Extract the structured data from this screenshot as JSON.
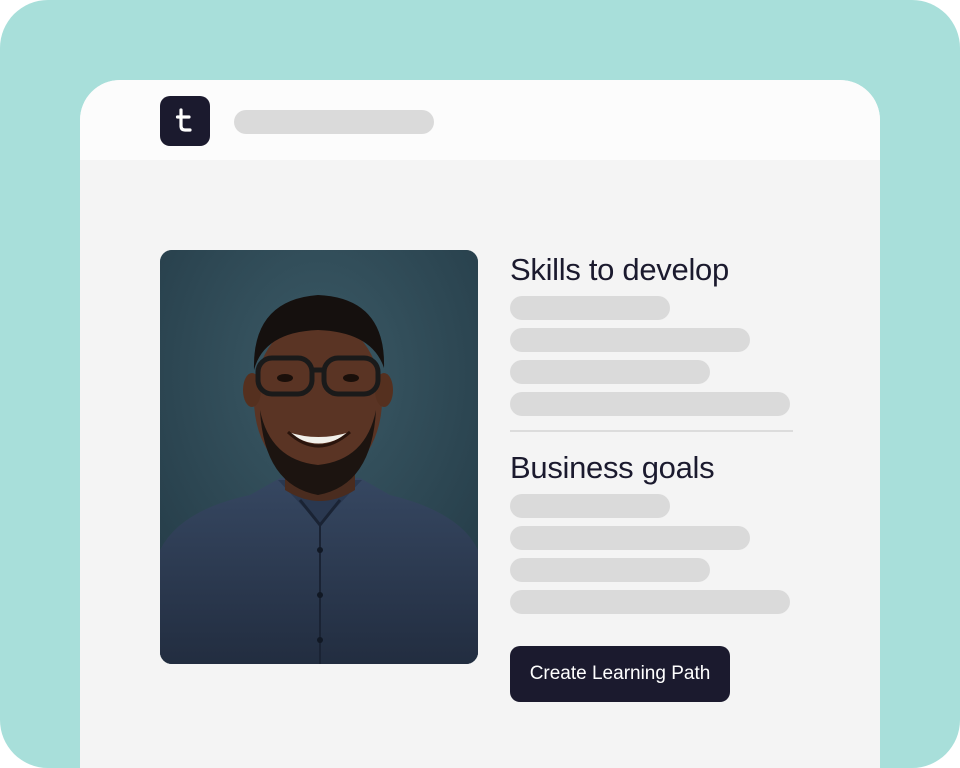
{
  "app": {
    "logo_icon": "brand-logo-icon",
    "accent_color": "#a8dfda",
    "brand_color": "#1b1a2e"
  },
  "profile": {
    "image": "portrait-photo"
  },
  "skills": {
    "title": "Skills to develop"
  },
  "goals": {
    "title": "Business goals"
  },
  "actions": {
    "create_label": "Create Learning Path"
  }
}
